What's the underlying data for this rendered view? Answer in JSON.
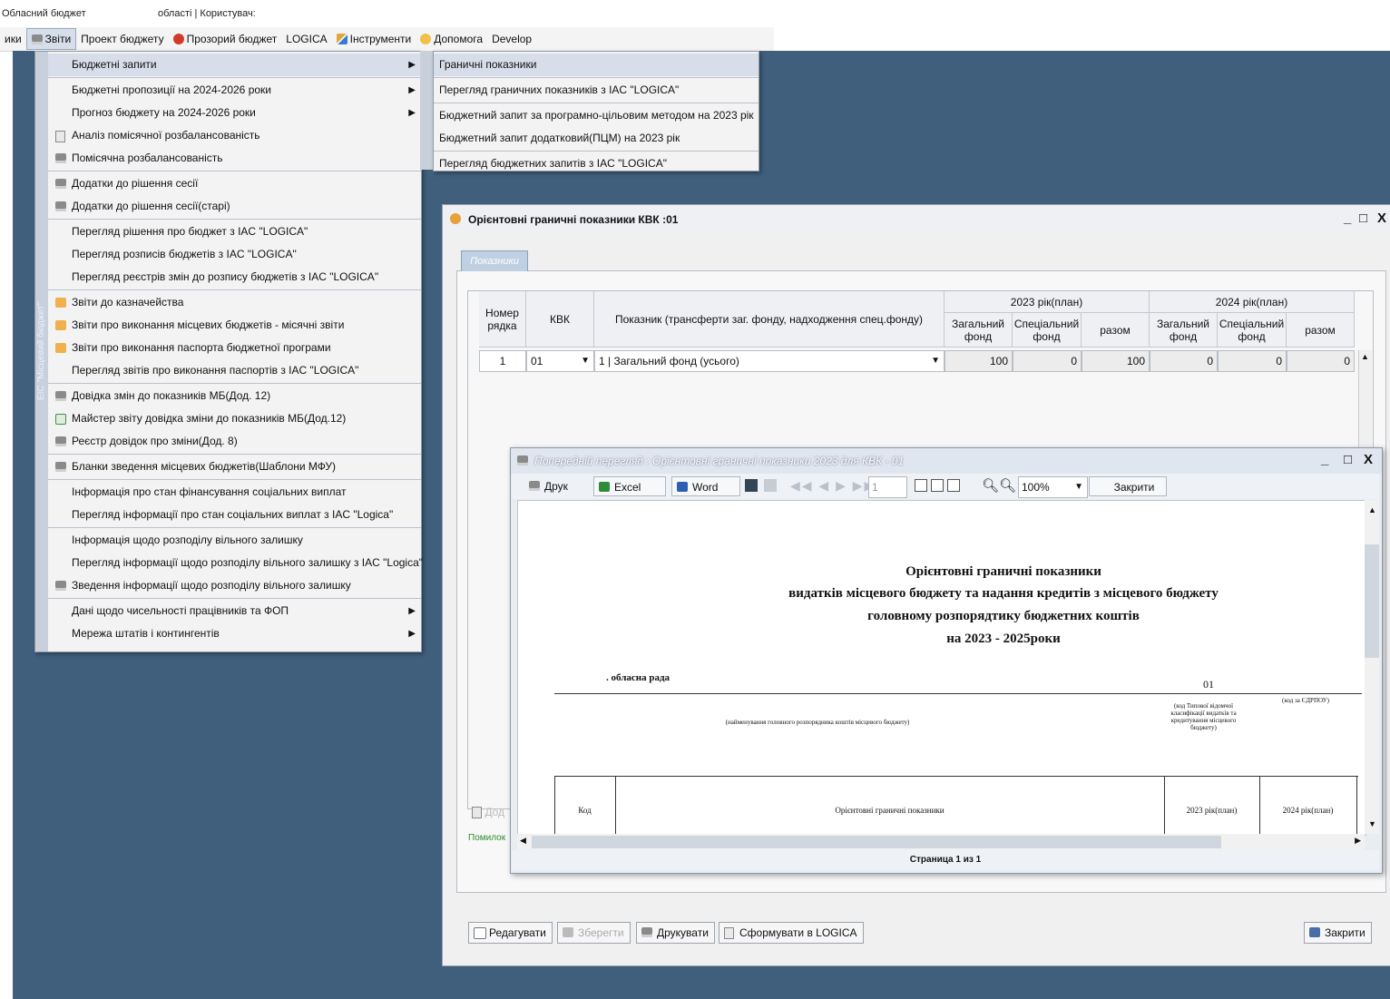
{
  "titlebar": {
    "left": "Обласний бюджет",
    "right": "області | Користувач:"
  },
  "menubar": {
    "items": [
      "ики",
      "Звіти",
      "Проект бюджету",
      "Прозорий бюджет",
      "LOGICA",
      "Інструменти",
      "Допомога",
      "Develop"
    ]
  },
  "menu_reports": {
    "strip": "ЕІС \"Місцевий бюджет\"",
    "items": [
      "Бюджетні запити",
      "Бюджетні пропозиції на 2024-2026 роки",
      "Прогноз бюджету на 2024-2026 роки",
      "Аналіз помісячної розбалансованість",
      "Помісячна розбалансованість",
      "Додатки до рішення сесії",
      "Додатки до рішення сесії(старі)",
      "Перегляд рішення про бюджет  з IAC \"LOGICA\"",
      "Перегляд розписів бюджетів  з IAC \"LOGICA\"",
      "Перегляд реєстрів змін до розпису бюджетів  з IAC \"LOGICA\"",
      "Звіти до казначейства",
      "Звіти про виконання місцевих бюджетів - місячні звіти",
      "Звіти про виконання паспорта бюджетної програми",
      "Перегляд звітів про виконання паспортів  з IAC \"LOGICA\"",
      "Довідка змін до показників МБ(Дод. 12)",
      "Майстер звіту довідка зміни до показників МБ(Дод.12)",
      "Реєстр довідок про зміни(Дод. 8)",
      "Бланки зведення місцевих бюджетів(Шаблони МФУ)",
      "Інформація про стан фінансування соціальних виплат",
      "Перегляд інформації про стан соціальних виплат з IAC \"Logica\"",
      "Інформація щодо розподілу вільного залишку",
      "Перегляд інформації щодо розподілу вільного залишку з IAC \"Logica\"",
      "Зведення інформації щодо розподілу вільного залишку",
      "Дані щодо чисельності працівників та ФОП",
      "Мережа штатів і контингентів"
    ]
  },
  "menu_budget_requests": {
    "items": [
      "Граничні показники",
      "Перегляд граничних показників  з IAC \"LOGICA\"",
      "Бюджетний запит за програмно-цільовим методом на 2023 рік",
      "Бюджетний запит додатковий(ПЦМ) на 2023 рік",
      "Перегляд бюджетних запитів  з IAC \"LOGICA\""
    ]
  },
  "window_indicators": {
    "title": "Орієнтовні граничні показники КВК :01",
    "controls": [
      "_",
      "□",
      "X"
    ],
    "tab": "Показники",
    "grid": {
      "headers": {
        "row_no": "Номер рядка",
        "kvk": "КВК",
        "indicator": "Показник (трансферти заг. фонду, надходження спец.фонду)",
        "year1": "2023 рік(план)",
        "year2": "2024 рік(план)",
        "general": "Загальний фонд",
        "special": "Спеціальний фонд",
        "total": "разом"
      },
      "row": {
        "no": "1",
        "kvk": "01",
        "indicator": "1 | Загальний фонд (усього)",
        "v1": "100",
        "v2": "0",
        "v3": "100",
        "v4": "0",
        "v5": "0",
        "v6": "0"
      }
    },
    "hidden_button": "Дод",
    "hidden_status": "Помилок",
    "buttons": {
      "edit": "Редагувати",
      "save": "Зберегти",
      "print": "Друкувати",
      "form": "Сформувати в LOGICA",
      "close": "Закрити"
    }
  },
  "window_preview": {
    "title": "Попередній перегляд : Орієнтовні граничні показники 2023 для КВК - 01",
    "controls": [
      "_",
      "□",
      "X"
    ],
    "toolbar": {
      "print": "Друк",
      "excel": "Excel",
      "word": "Word",
      "page": "1",
      "zoom": "100%",
      "close": "Закрити"
    },
    "doc": {
      "title1": "Орієнтовні граничні показники",
      "title2": "видатків місцевого бюджету та надання кредитів з місцевого бюджету",
      "title3": "головному розпорядтику бюджетних коштів",
      "title4": "на 2023 - 2025роки",
      "org": ". обласна рада",
      "code": "01",
      "caption_org": "(найменування головного розпорядника коштів місцевого бюджету)",
      "caption_code": "(код Типової відомчої класифікації видатків та кредитування місцевого бюджету)",
      "caption_edrpou": "(код за ЄДРПОУ)",
      "col_code": "Код",
      "col_name": "Орієнтовні граничні показники",
      "col_y1": "2023 рік(план)",
      "col_y2": "2024 рік(план)"
    },
    "pagebar": "Страница 1 из 1"
  }
}
